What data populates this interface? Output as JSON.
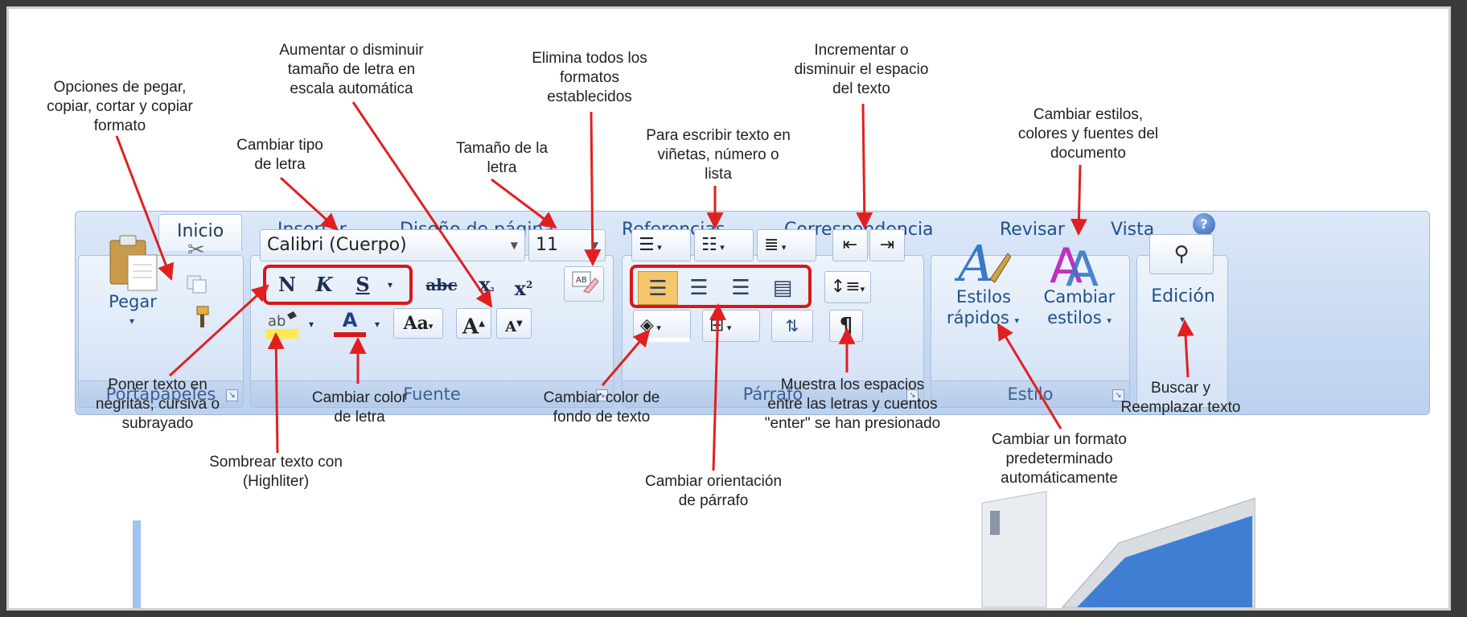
{
  "annotations": {
    "paste_options": "Opciones de pegar,\ncopiar, cortar y copiar\nformato",
    "font_type": "Cambiar tipo\nde letra",
    "font_grow": "Aumentar o disminuir\ntamaño de letra en\nescala automática",
    "font_size": "Tamaño de la\nletra",
    "clear_format": "Elimina todos los\nformatos\nestablecidos",
    "bullets": "Para escribir texto en\nviñetas, número o\nlista",
    "indent": "Incrementar o\ndisminuir el espacio\ndel texto",
    "styles": "Cambiar estilos,\ncolores y fuentes del\ndocumento",
    "bold_italic": "Poner texto en\nnegritas, cursiva o\nsubrayado",
    "font_color": "Cambiar color\nde letra",
    "highlight": "Sombrear texto con\n(Highliter)",
    "shading": "Cambiar color de\nfondo de texto",
    "alignment": "Cambiar orientación\nde párrafo",
    "show_marks": "Muestra los espacios\nentre las letras y cuentos\n\"enter\" se han presionado",
    "quick_styles": "Cambiar un formato\npredeterminado\nautomáticamente",
    "find_replace": "Buscar y\nReemplazar texto"
  },
  "tabs": [
    "Inicio",
    "Insertar",
    "Diseño de página",
    "Referencias",
    "Correspondencia",
    "Revisar",
    "Vista"
  ],
  "groups": {
    "clipboard": "Portapapeles",
    "font": "Fuente",
    "paragraph": "Párrafo",
    "styles": "Estilo",
    "editing": "Edición"
  },
  "font_name": "Calibri (Cuerpo)",
  "font_size": "11",
  "buttons": {
    "paste": "Pegar",
    "quick_styles_1": "Estilos",
    "quick_styles_2": "rápidos",
    "change_styles_1": "Cambiar",
    "change_styles_2": "estilos",
    "editing": "Edición"
  },
  "glyphs": {
    "bold": "N",
    "italic": "K",
    "underline": "S",
    "strike": "abc",
    "grow": "A",
    "shrink": "A",
    "case": "Aa",
    "pilcrow": "¶"
  },
  "colors": {
    "ribbon": "#c8daf2",
    "tab_text": "#1f4f8c",
    "callout_arrow": "#e02020",
    "highlight_yellow": "#ffe94d",
    "font_color_red": "#d81818",
    "alignment_active": "#f5c66a"
  }
}
